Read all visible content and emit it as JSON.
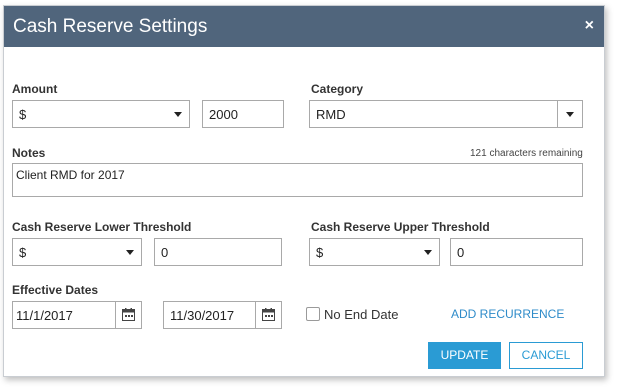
{
  "dialog": {
    "title": "Cash Reserve Settings",
    "close_glyph": "×"
  },
  "amount": {
    "label": "Amount",
    "type_value": "$",
    "value": "2000"
  },
  "category": {
    "label": "Category",
    "value": "RMD"
  },
  "notes": {
    "label": "Notes",
    "chars_remaining": "121 characters remaining",
    "value": "Client RMD for 2017"
  },
  "lower_threshold": {
    "label": "Cash Reserve Lower Threshold",
    "type_value": "$",
    "value": "0"
  },
  "upper_threshold": {
    "label": "Cash Reserve Upper Threshold",
    "type_value": "$",
    "value": "0"
  },
  "effective_dates": {
    "label": "Effective Dates",
    "start": "11/1/2017",
    "end": "11/30/2017",
    "no_end_date_label": "No End Date",
    "no_end_date_checked": false,
    "add_recurrence_label": "ADD RECURRENCE"
  },
  "footer": {
    "update_label": "UPDATE",
    "cancel_label": "CANCEL"
  },
  "colors": {
    "titlebar": "#50657c",
    "accent": "#2a9bd4"
  },
  "icons": {
    "close": "close-icon",
    "dropdown": "chevron-down-icon",
    "calendar": "calendar-icon"
  }
}
